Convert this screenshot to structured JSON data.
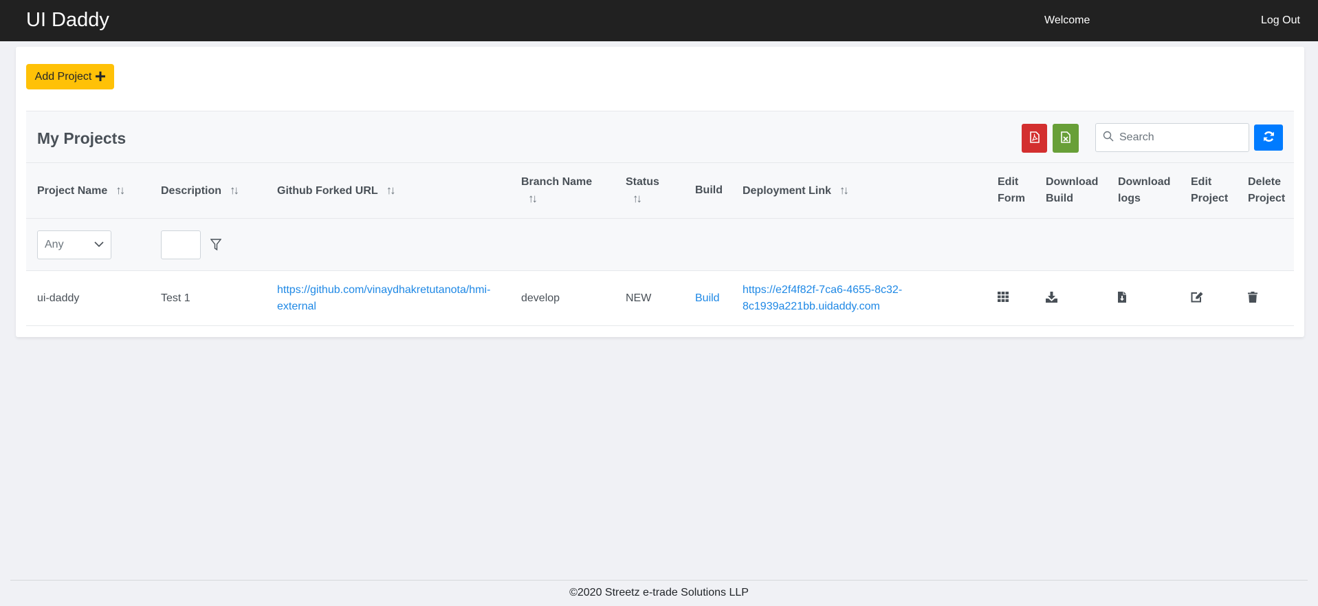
{
  "navbar": {
    "brand": "UI Daddy",
    "welcome": "Welcome",
    "logout": "Log Out"
  },
  "toolbar": {
    "add_project_label": "Add Project",
    "add_project_icon": "plus-icon"
  },
  "panel": {
    "title": "My Projects",
    "export_pdf_icon": "file-pdf-icon",
    "export_excel_icon": "file-excel-icon",
    "search_placeholder": "Search",
    "search_value": "",
    "refresh_icon": "refresh-icon",
    "colors": {
      "pdf": "#d32f2f",
      "excel": "#689f38",
      "refresh": "#007bff",
      "add": "#ffc107",
      "link": "#1e88e5"
    }
  },
  "table": {
    "columns": [
      {
        "label": "Project Name",
        "line1": "Project Name",
        "line2": "",
        "sortable": true
      },
      {
        "label": "Description",
        "line1": "Description",
        "line2": "",
        "sortable": true
      },
      {
        "label": "Github Forked URL",
        "line1": "Github Forked URL",
        "line2": "",
        "sortable": true
      },
      {
        "label": "Branch Name",
        "line1": "Branch Name",
        "line2": "",
        "sortable": true
      },
      {
        "label": "Status",
        "line1": "Status",
        "line2": "",
        "sortable": true
      },
      {
        "label": "Build",
        "line1": "Build",
        "line2": "",
        "sortable": false
      },
      {
        "label": "Deployment Link",
        "line1": "Deployment Link",
        "line2": "",
        "sortable": true
      },
      {
        "label": "Edit Form",
        "line1": "Edit",
        "line2": "Form",
        "sortable": false
      },
      {
        "label": "Download Build",
        "line1": "Download",
        "line2": "Build",
        "sortable": false
      },
      {
        "label": "Download logs",
        "line1": "Download",
        "line2": "logs",
        "sortable": false
      },
      {
        "label": "Edit Project",
        "line1": "Edit",
        "line2": "Project",
        "sortable": false
      },
      {
        "label": "Delete Project",
        "line1": "Delete",
        "line2": "Project",
        "sortable": false
      }
    ],
    "sort_glyph": "↑↓",
    "filters": {
      "project_name_select": "Any",
      "description_value": "",
      "filter_icon": "filter-icon"
    },
    "rows": [
      {
        "project_name": "ui-daddy",
        "description": "Test 1",
        "github_url_line1": "https://github.com/vinaydhakretutanota/hmi-",
        "github_url_line2": "external",
        "branch_name": "develop",
        "status": "NEW",
        "build": "Build",
        "deployment_line1": "https://e2f4f82f-7ca6-4655-8c32-",
        "deployment_line2": "8c1939a221bb.uidaddy.com",
        "actions": [
          "grid-icon",
          "download-icon",
          "file-download-icon",
          "edit-icon",
          "trash-icon"
        ]
      }
    ]
  },
  "footer": {
    "text": "©2020 Streetz e-trade Solutions LLP"
  }
}
